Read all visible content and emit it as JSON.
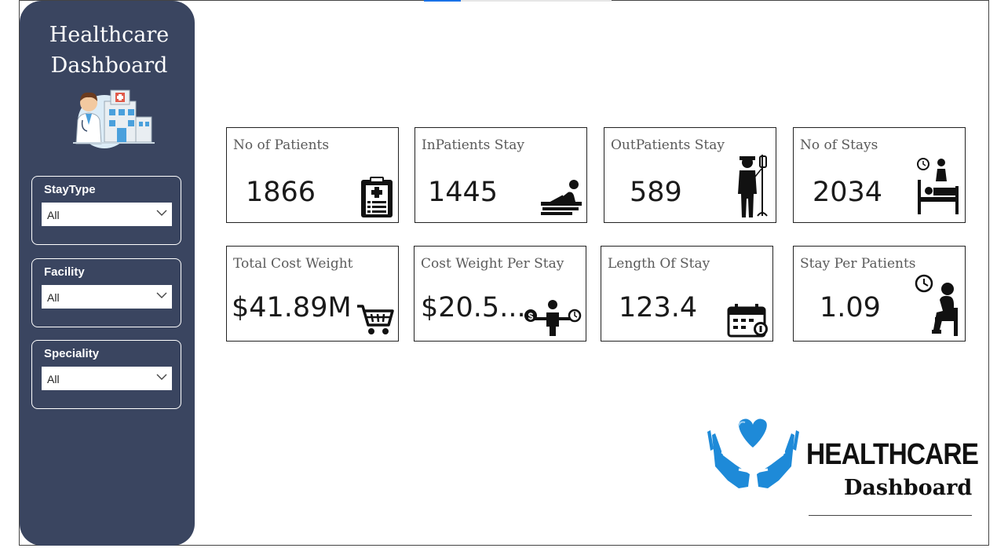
{
  "sidebar": {
    "title_line1": "Healthcare",
    "title_line2": "Dashboard",
    "illustration": "doctor-hospital-illustration",
    "slicers": [
      {
        "label": "StayType",
        "value": "All"
      },
      {
        "label": "Facility",
        "value": "All"
      },
      {
        "label": "Speciality",
        "value": "All"
      }
    ]
  },
  "cards": [
    {
      "title": "No of Patients",
      "value": "1866",
      "icon": "clipboard-icon"
    },
    {
      "title": "InPatients Stay",
      "value": "1445",
      "icon": "patient-bed-icon"
    },
    {
      "title": "OutPatients Stay",
      "value": "589",
      "icon": "iv-drip-patient-icon"
    },
    {
      "title": "No of Stays",
      "value": "2034",
      "icon": "hospital-bed-icon"
    },
    {
      "title": "Total Cost Weight",
      "value": "$41.89M",
      "icon": "shopping-cart-icon"
    },
    {
      "title": "Cost Weight Per Stay",
      "value": "$20.5...",
      "icon": "cost-balance-icon"
    },
    {
      "title": "Length Of Stay",
      "value": "123.4",
      "icon": "calendar-icon"
    },
    {
      "title": "Stay Per Patients",
      "value": "1.09",
      "icon": "waiting-person-icon"
    }
  ],
  "logo": {
    "word": "HEALTHCARE",
    "sub": "Dashboard",
    "icon": "heart-hands-icon",
    "colors": {
      "blue": "#1e8ad8",
      "dark": "#111111"
    }
  },
  "colors": {
    "sidebar": "#3a4560",
    "accent": "#1a73e8"
  }
}
